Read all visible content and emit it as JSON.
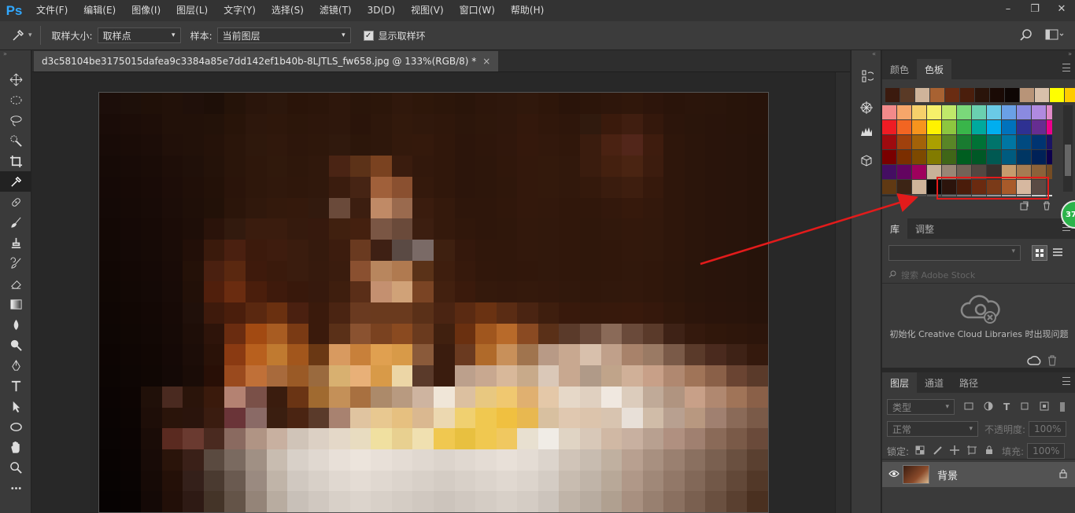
{
  "app": {
    "logo": "Ps"
  },
  "menu": [
    "文件(F)",
    "编辑(E)",
    "图像(I)",
    "图层(L)",
    "文字(Y)",
    "选择(S)",
    "滤镜(T)",
    "3D(D)",
    "视图(V)",
    "窗口(W)",
    "帮助(H)"
  ],
  "window_buttons": {
    "minimize": "–",
    "restore": "❐",
    "close": "✕"
  },
  "options": {
    "sample_size_label": "取样大小:",
    "sample_size_value": "取样点",
    "sample_label": "样本:",
    "sample_value": "当前图层",
    "show_ring_label": "显示取样环",
    "show_ring_checked": true
  },
  "document": {
    "tab_title": "d3c58104be3175015dafea9c3384a85e7dd142ef1b40b-8LJTLS_fw658.jpg @ 133%(RGB/8) *",
    "tab_close": "×"
  },
  "panels": {
    "color_tab": "颜色",
    "swatches_tab": "色板",
    "library_tab": "库",
    "adjust_tab": "调整",
    "library_search_placeholder": "搜索 Adobe Stock",
    "library_message": "初始化 Creative Cloud Libraries 时出现问题",
    "layers_tab": "图层",
    "channels_tab": "通道",
    "paths_tab": "路径",
    "filter_kind": "类型",
    "blend_mode": "正常",
    "opacity_label": "不透明度:",
    "opacity_value": "100%",
    "lock_label": "锁定:",
    "fill_label": "填充:",
    "fill_value": "100%",
    "layer_name": "背景"
  },
  "swatches": {
    "recent": [
      "#3b1a0e",
      "#5a3a26",
      "#cfb49a",
      "#a86232",
      "#6a2c12",
      "#4a1e0c",
      "#2a140a",
      "#1a0a05",
      "#0e0604",
      "#b89478",
      "#d8c0aa",
      "#ffff00",
      "#ffcc00"
    ],
    "rows": [
      [
        "#f28a8a",
        "#f6a66a",
        "#f6d06a",
        "#f6f06a",
        "#c0e86a",
        "#7ad87a",
        "#6ad0b0",
        "#6acae6",
        "#6aa0e6",
        "#8a8ae0",
        "#b08ae0",
        "#e08ac8"
      ],
      [
        "#ee1c24",
        "#f26522",
        "#f7941d",
        "#fff200",
        "#8dc63f",
        "#39b54a",
        "#00a99d",
        "#00aeef",
        "#0072bc",
        "#2e3192",
        "#662d91",
        "#ec008c"
      ],
      [
        "#9e0b0f",
        "#a0410d",
        "#a36209",
        "#aba000",
        "#598527",
        "#197b30",
        "#007236",
        "#00746b",
        "#0076a3",
        "#004a80",
        "#003471",
        "#1b1464"
      ],
      [
        "#790000",
        "#7b2e00",
        "#7d4900",
        "#827b00",
        "#406618",
        "#005e20",
        "#005826",
        "#005952",
        "#005b7f",
        "#003663",
        "#002157",
        "#0d004c"
      ],
      [
        "#440e62",
        "#630460",
        "#9e005d",
        "#c7b299",
        "#998675",
        "#736357",
        "#534741",
        "#37302d",
        "#c69c6d",
        "#a67c52",
        "#8c6239",
        "#754c24"
      ],
      [
        "#603913",
        "#3c2415",
        "#cfb49a",
        "#0a0605",
        "#2c140c",
        "#4a1c0a",
        "#6a2a10",
        "#7a3a18",
        "#a85a2a",
        "#d6b8a0",
        "#5a4a44",
        "#3a3a3a"
      ],
      [
        "#2a2a2a",
        "#3a3a3a",
        "#4a4a4a",
        "#5a5a5a",
        "#6a6a6a",
        "#7a7a7a",
        "#8a8a8a",
        "#9a9a9a",
        "#aaaaaa",
        "#bababa",
        "#cacaca",
        "#dadada"
      ]
    ]
  },
  "badge": {
    "text": "37"
  },
  "canvas_pixels": [
    [
      "#1c0e0a",
      "#1e100a",
      "#201008",
      "#221109",
      "#20100a",
      "#1e0f08",
      "#251309",
      "#2a150b",
      "#2c170c",
      "#2a1409",
      "#2b150a",
      "#2e170c",
      "#2a150a",
      "#2c160a",
      "#30180c",
      "#2e170a",
      "#2c160a",
      "#2a150a",
      "#2d160b",
      "#2e170c",
      "#30180c",
      "#2e160a",
      "#2a140a",
      "#2c150a",
      "#2e160b",
      "#30170b",
      "#2d150b",
      "#2a140a",
      "#2b150b",
      "#2a150b",
      "#28140a",
      "#27130a"
    ],
    [
      "#1a0c08",
      "#1c0d08",
      "#1e0e08",
      "#221109",
      "#221109",
      "#231209",
      "#281409",
      "#2d170c",
      "#2e170b",
      "#2c160a",
      "#2d160b",
      "#2e170c",
      "#2a140a",
      "#2e170b",
      "#32190c",
      "#30180c",
      "#2f170b",
      "#2c160b",
      "#2e170b",
      "#2f170c",
      "#33180c",
      "#30170b",
      "#2e160b",
      "#301a0e",
      "#3a1a0c",
      "#401e10",
      "#34180c",
      "#2c150b",
      "#2a150b",
      "#29140b",
      "#28140a",
      "#27130a"
    ],
    [
      "#180b07",
      "#1a0c07",
      "#1c0d08",
      "#211009",
      "#221109",
      "#251209",
      "#2a150a",
      "#2e180c",
      "#30180c",
      "#2d160b",
      "#2e170b",
      "#30190d",
      "#2c160a",
      "#2e170b",
      "#33190c",
      "#34190c",
      "#30170b",
      "#2c150b",
      "#2e160b",
      "#30170c",
      "#34180c",
      "#32180c",
      "#30170b",
      "#3a1c0e",
      "#4a2212",
      "#52261a",
      "#3e1c0e",
      "#2e160b",
      "#2b150b",
      "#29140b",
      "#28140b",
      "#26130a"
    ],
    [
      "#160a06",
      "#180b07",
      "#1a0c07",
      "#1e0e08",
      "#201009",
      "#241209",
      "#2a150a",
      "#2e170b",
      "#30190c",
      "#2e170b",
      "#30180c",
      "#4a2414",
      "#5c3218",
      "#7a4220",
      "#3a1c0e",
      "#32180c",
      "#30170b",
      "#2c150b",
      "#2d160b",
      "#30170b",
      "#33180c",
      "#33190c",
      "#31180c",
      "#3a1c0e",
      "#44200f",
      "#4a2412",
      "#3c1c0e",
      "#2e160b",
      "#2b150b",
      "#29140b",
      "#28140b",
      "#26130a"
    ],
    [
      "#150906",
      "#170a06",
      "#190b07",
      "#1d0d08",
      "#200f08",
      "#231108",
      "#2a140a",
      "#2e170b",
      "#30180c",
      "#2f170b",
      "#30180c",
      "#3a1c0e",
      "#462414",
      "#a0603a",
      "#8a5030",
      "#34190c",
      "#30170b",
      "#2c150b",
      "#2d160b",
      "#2f170b",
      "#33180c",
      "#33190c",
      "#31180c",
      "#34190c",
      "#3a1c0e",
      "#3e1e0f",
      "#36190c",
      "#2e160b",
      "#2b150b",
      "#29140b",
      "#28140b",
      "#26130a"
    ],
    [
      "#140906",
      "#160a06",
      "#180b07",
      "#1c0d08",
      "#1f0f08",
      "#221108",
      "#2b150a",
      "#30180c",
      "#33190c",
      "#34190c",
      "#321a0e",
      "#6a4a3a",
      "#3c1e10",
      "#c08a66",
      "#9a6a4e",
      "#3a1c0e",
      "#34190c",
      "#2e160b",
      "#2e160b",
      "#30170b",
      "#33180c",
      "#32180c",
      "#30170b",
      "#30170b",
      "#33180c",
      "#36190c",
      "#33180c",
      "#2e160b",
      "#2b150b",
      "#29140b",
      "#28140b",
      "#26130a"
    ],
    [
      "#130805",
      "#150906",
      "#170a06",
      "#1b0c07",
      "#1e0e08",
      "#2a130a",
      "#321a0e",
      "#3a1c0e",
      "#3a1c0e",
      "#351a0d",
      "#36190d",
      "#40200f",
      "#44200f",
      "#7a5644",
      "#6a4a3a",
      "#3c1e10",
      "#34190c",
      "#30170b",
      "#2e160b",
      "#2f170b",
      "#32180c",
      "#31180c",
      "#30170b",
      "#2f170b",
      "#31180c",
      "#33180c",
      "#32180c",
      "#2e160b",
      "#2b150b",
      "#29140b",
      "#28140b",
      "#26130a"
    ],
    [
      "#120805",
      "#140906",
      "#160a06",
      "#1a0c07",
      "#220f08",
      "#3a1a0c",
      "#4a2010",
      "#3c1a0c",
      "#3e1c0e",
      "#3a1c0e",
      "#351a0d",
      "#3c1c0e",
      "#6a3a20",
      "#3e2014",
      "#5a4a44",
      "#7a6a66",
      "#3e2010",
      "#34180c",
      "#30170b",
      "#30170b",
      "#32180c",
      "#31180c",
      "#30170b",
      "#2f170b",
      "#30170b",
      "#32180c",
      "#31180c",
      "#2e160b",
      "#2b150b",
      "#29140b",
      "#28140b",
      "#26130a"
    ],
    [
      "#110704",
      "#130805",
      "#150906",
      "#190b07",
      "#241108",
      "#4a2010",
      "#5a2810",
      "#3e1a0c",
      "#3a1a0c",
      "#3a1c0e",
      "#361a0d",
      "#3a1c0e",
      "#8a5030",
      "#b8865e",
      "#b07a50",
      "#5a3218",
      "#3e1e0e",
      "#36190c",
      "#31170b",
      "#30170b",
      "#31170b",
      "#31180c",
      "#30170b",
      "#2f170b",
      "#30170b",
      "#31180c",
      "#30170b",
      "#2d160b",
      "#2a150b",
      "#29140b",
      "#28140b",
      "#26130a"
    ],
    [
      "#100704",
      "#120805",
      "#140906",
      "#180b07",
      "#221008",
      "#501f0c",
      "#6a2c10",
      "#4a1e0c",
      "#3e1a0c",
      "#38180b",
      "#36190d",
      "#3e1e0e",
      "#5a2e18",
      "#c49070",
      "#d0a278",
      "#7a4424",
      "#42200f",
      "#3a1a0c",
      "#34190c",
      "#33180c",
      "#34190c",
      "#33180c",
      "#31180c",
      "#30170b",
      "#31180c",
      "#32180c",
      "#30170b",
      "#2d160b",
      "#2a150b",
      "#29140b",
      "#28140b",
      "#26130a"
    ],
    [
      "#0f0604",
      "#110704",
      "#130805",
      "#170a06",
      "#20100a",
      "#3e1a0c",
      "#4a1e0c",
      "#5a2810",
      "#6a3010",
      "#4a2010",
      "#3a1a0c",
      "#4a2412",
      "#6a3a20",
      "#6a3a1e",
      "#6a3a1e",
      "#5a3018",
      "#4a2412",
      "#5a2a12",
      "#6a3212",
      "#5a2c14",
      "#4a2412",
      "#3e1e0e",
      "#38190c",
      "#36190c",
      "#37190c",
      "#38190c",
      "#35180c",
      "#30170b",
      "#2c150b",
      "#2a140b",
      "#29140b",
      "#27130a"
    ],
    [
      "#0e0604",
      "#100704",
      "#120805",
      "#160a06",
      "#1e0e08",
      "#2e140a",
      "#6a2c10",
      "#a24a12",
      "#a85c22",
      "#7a3a14",
      "#3a1a0c",
      "#5a3018",
      "#8a5230",
      "#7a4220",
      "#8a4a20",
      "#6a3a1e",
      "#40200f",
      "#6a3010",
      "#a0561e",
      "#b86a2a",
      "#8a4a22",
      "#5a3018",
      "#5a3a2a",
      "#6a4a3a",
      "#8a6a58",
      "#6a4a3a",
      "#5a3a2a",
      "#3e2216",
      "#34190d",
      "#30170b",
      "#2e160b",
      "#2c150b"
    ],
    [
      "#0d0503",
      "#0f0604",
      "#110704",
      "#150906",
      "#1c0d08",
      "#2a1208",
      "#8a3a12",
      "#b8601e",
      "#c07a30",
      "#a2561c",
      "#6a3814",
      "#d89a60",
      "#c8803a",
      "#e0a050",
      "#d89a48",
      "#8a5a3a",
      "#3a1c0e",
      "#6a3a20",
      "#b06a2a",
      "#c8905a",
      "#a0744e",
      "#b89a86",
      "#c8a890",
      "#d8c0ac",
      "#c0a08a",
      "#a8826a",
      "#9a7a64",
      "#7a5a48",
      "#5a3a2a",
      "#4a2a1e",
      "#3e2216",
      "#34190d"
    ],
    [
      "#0c0503",
      "#0e0604",
      "#100704",
      "#140906",
      "#1a0c07",
      "#280f06",
      "#9a4a1e",
      "#c07038",
      "#a86a3c",
      "#9a5a26",
      "#9a6a3e",
      "#d8b070",
      "#e8b078",
      "#d89a48",
      "#ecd6a6",
      "#5a3a2a",
      "#3a1c0e",
      "#bca08c",
      "#c8a890",
      "#d8b89a",
      "#c8aa8a",
      "#dac8b8",
      "#c8a890",
      "#b09a88",
      "#c0a48a",
      "#d0b098",
      "#c8a088",
      "#b08870",
      "#a07458",
      "#8a6048",
      "#6a4432",
      "#5a3a2a"
    ],
    [
      "#0b0403",
      "#0d0503",
      "#201009",
      "#4a2a20",
      "#2a140a",
      "#3a1a0c",
      "#b48272",
      "#7a5048",
      "#3a1c0e",
      "#6a3414",
      "#a06a30",
      "#c49058",
      "#a87040",
      "#ac8a6a",
      "#b89a80",
      "#ceb4a0",
      "#f0e6d8",
      "#dcc0a0",
      "#e8c880",
      "#f0c870",
      "#e0b070",
      "#e4c8a8",
      "#e6d8c8",
      "#e0d0c0",
      "#f0e8e0",
      "#dcccbc",
      "#c0aa98",
      "#b09480",
      "#c8a088",
      "#b08870",
      "#a07458",
      "#8a6048"
    ],
    [
      "#0a0403",
      "#0c0503",
      "#1e0e08",
      "#2a140a",
      "#2a140c",
      "#3a1c10",
      "#6a3438",
      "#8a6a66",
      "#3a1e10",
      "#4a2412",
      "#5a3a2a",
      "#a88270",
      "#e0c4a0",
      "#e8c890",
      "#e6c080",
      "#dab890",
      "#ecd8b0",
      "#f0d070",
      "#f0c850",
      "#f0c040",
      "#e8b850",
      "#d8c0a0",
      "#e0c8b0",
      "#dcc4ac",
      "#d8c4b0",
      "#e8e0d8",
      "#d0bca8",
      "#b8a090",
      "#b89880",
      "#a08070",
      "#8a6a58",
      "#7a5a48"
    ],
    [
      "#090403",
      "#0b0403",
      "#1a0c07",
      "#5a2a20",
      "#6a3a30",
      "#4a2a20",
      "#8a6a60",
      "#b09484",
      "#c8b0a0",
      "#d0c4b8",
      "#dcd0c4",
      "#e4d8c8",
      "#e8dcc0",
      "#f0e0a0",
      "#e8d090",
      "#f0e0b0",
      "#f0c850",
      "#e8c040",
      "#f0c850",
      "#f0c860",
      "#e8e0d0",
      "#f0ece6",
      "#e0d4c4",
      "#d8c8b8",
      "#d0b8a4",
      "#c8b0a0",
      "#b8a090",
      "#b09080",
      "#a08070",
      "#8a6a58",
      "#7a5a48",
      "#6a4a3a"
    ],
    [
      "#080302",
      "#0a0403",
      "#180b07",
      "#2a140a",
      "#3a2018",
      "#5a4a40",
      "#7a6a60",
      "#a09084",
      "#c8bcb0",
      "#d8d0c8",
      "#e0d8d0",
      "#e8e0d8",
      "#ece4dc",
      "#e8e0d8",
      "#e4dcd4",
      "#e0d8d0",
      "#dcd4cc",
      "#e0d8d0",
      "#e4dcd4",
      "#e8e0d8",
      "#e4dcd4",
      "#dcd4cc",
      "#d0c4b8",
      "#c8bcb0",
      "#c0b0a0",
      "#b8a090",
      "#a89080",
      "#9a8070",
      "#8a7060",
      "#7a6050",
      "#6a5040",
      "#5a4030"
    ],
    [
      "#070302",
      "#090403",
      "#160a06",
      "#241008",
      "#34201a",
      "#4a3a30",
      "#6a5a50",
      "#9a8a80",
      "#c0b4a8",
      "#d0c8c0",
      "#d8d0c8",
      "#e0d8d0",
      "#e4dcd4",
      "#e0d8d0",
      "#dcd4cc",
      "#d8d0c8",
      "#d4ccc4",
      "#d8d0c8",
      "#dcd4cc",
      "#e0d8d0",
      "#dcd4cc",
      "#d4ccc4",
      "#c8bcb0",
      "#c0b4a8",
      "#b8a898",
      "#b09888",
      "#a08878",
      "#927868",
      "#826858",
      "#725848",
      "#624838",
      "#523828"
    ],
    [
      "#060202",
      "#080302",
      "#140906",
      "#220f08",
      "#2e1a14",
      "#443428",
      "#645448",
      "#948478",
      "#b8aca0",
      "#c8c0b8",
      "#d0c8c0",
      "#d8d0c8",
      "#dcd4cc",
      "#d8d0c8",
      "#d4ccc4",
      "#d0c8c0",
      "#ccc4bc",
      "#d0c8c0",
      "#d4ccc4",
      "#d8d0c8",
      "#d4ccc4",
      "#ccc4bc",
      "#c0b4a8",
      "#b8aca0",
      "#b0a090",
      "#a89080",
      "#988070",
      "#8a7060",
      "#7a6050",
      "#6a5040",
      "#5a4030",
      "#4a3020"
    ]
  ]
}
